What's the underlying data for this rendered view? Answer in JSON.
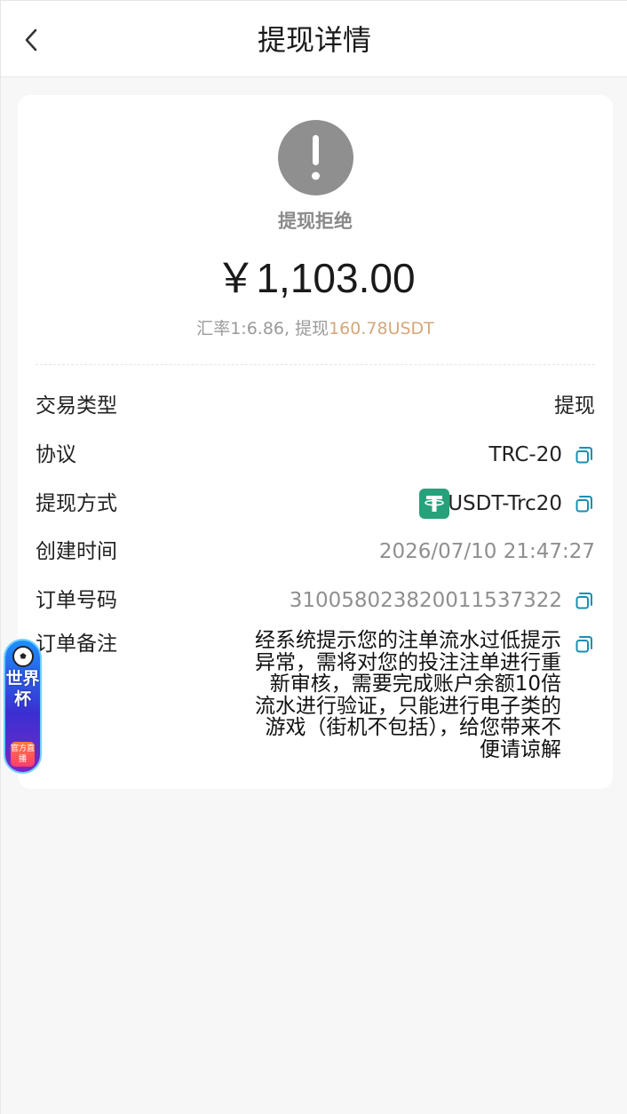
{
  "header": {
    "title": "提现详情"
  },
  "status": {
    "text": "提现拒绝",
    "icon": "exclamation-icon"
  },
  "amount": "￥1,103.00",
  "rate": {
    "prefix": "汇率1:6.86, 提现",
    "usdt": "160.78USDT"
  },
  "details": {
    "type_label": "交易类型",
    "type_value": "提现",
    "protocol_label": "协议",
    "protocol_value": "TRC-20",
    "method_label": "提现方式",
    "method_value": "USDT-Trc20",
    "created_label": "创建时间",
    "created_value": "2026/07/10 21:47:27",
    "order_label": "订单号码",
    "order_value": "310058023820011537322",
    "remark_label": "订单备注",
    "remark_value": "经系统提示您的注单流水过低提示异常，需将对您的投注注单进行重新审核，需要完成账户余额10倍流水进行验证，只能进行电子类的游戏（街机不包括），给您带来不便请谅解"
  },
  "badge": {
    "title": "世界杯",
    "live": "官方直播"
  },
  "colors": {
    "accent_orange": "#d4a77a",
    "copy_teal": "#1a8fb0",
    "usdt_green": "#26a17b",
    "status_gray": "#8f8f8f"
  }
}
